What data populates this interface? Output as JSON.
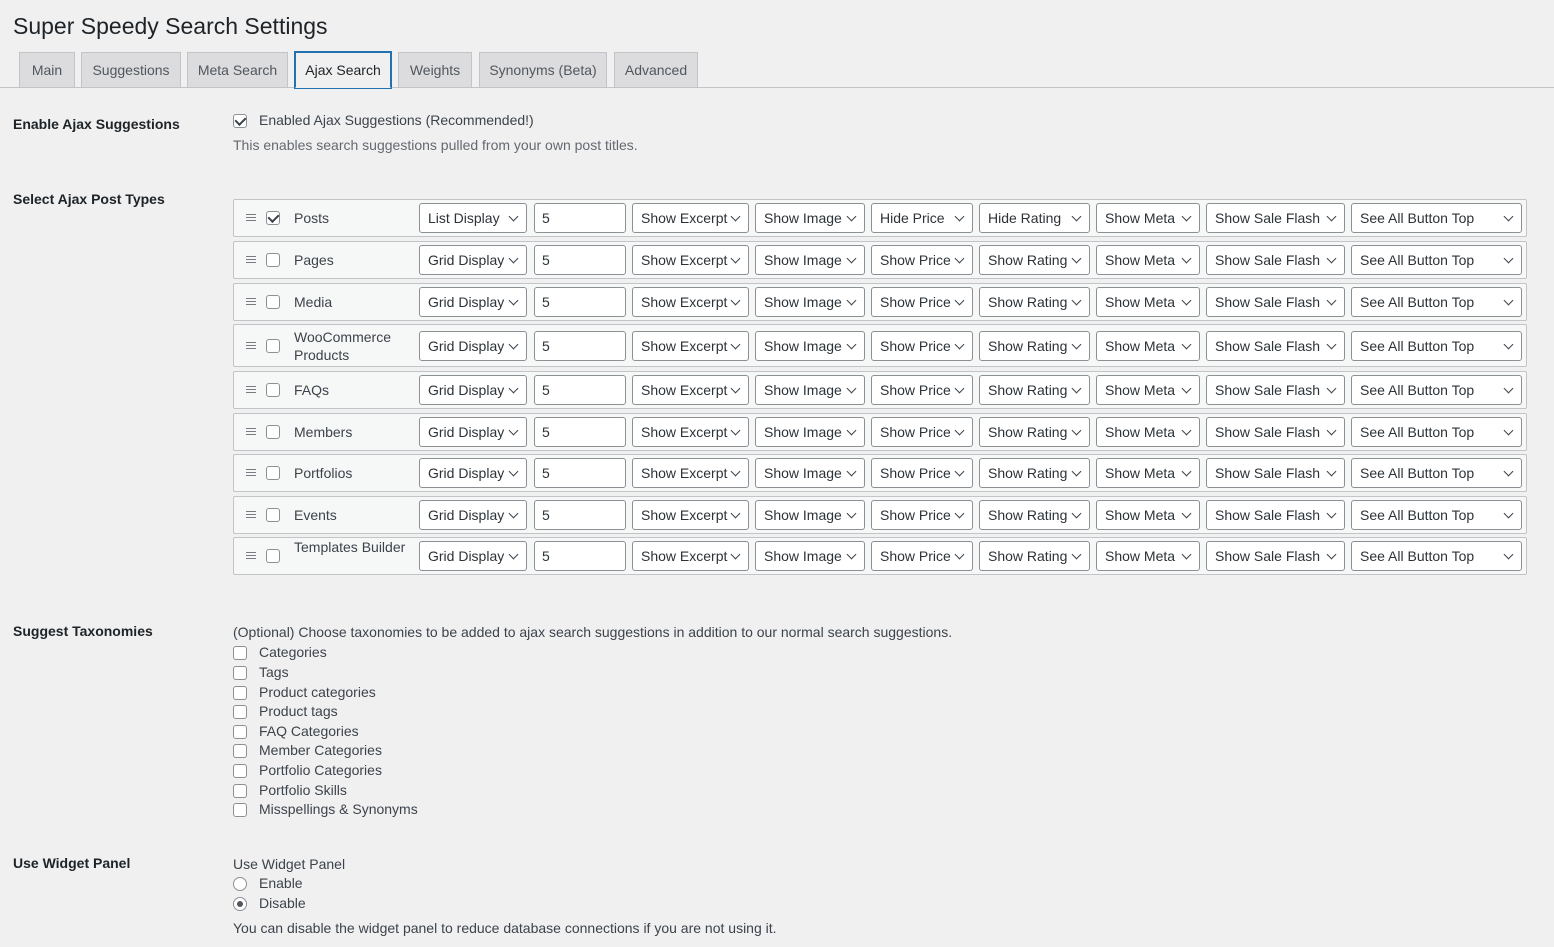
{
  "page_title": "Super Speedy Search Settings",
  "tabs": [
    {
      "label": "Main"
    },
    {
      "label": "Suggestions"
    },
    {
      "label": "Meta Search"
    },
    {
      "label": "Ajax Search",
      "active": true
    },
    {
      "label": "Weights"
    },
    {
      "label": "Synonyms (Beta)"
    },
    {
      "label": "Advanced"
    }
  ],
  "enable_ajax": {
    "label": "Enable Ajax Suggestions",
    "checkbox_label": "Enabled Ajax Suggestions (Recommended!)",
    "checked": true,
    "description": "This enables search suggestions pulled from your own post titles."
  },
  "post_types": {
    "label": "Select Ajax Post Types",
    "rows": [
      {
        "name": "Posts",
        "checked": true,
        "display": "List Display",
        "count": "5",
        "excerpt": "Show Excerpt",
        "image": "Show Image",
        "price": "Hide Price",
        "rating": "Hide Rating",
        "meta": "Show Meta",
        "sale": "Show Sale Flash",
        "see_all": "See All Button Top"
      },
      {
        "name": "Pages",
        "checked": false,
        "display": "Grid Display",
        "count": "5",
        "excerpt": "Show Excerpt",
        "image": "Show Image",
        "price": "Show Price",
        "rating": "Show Rating",
        "meta": "Show Meta",
        "sale": "Show Sale Flash",
        "see_all": "See All Button Top"
      },
      {
        "name": "Media",
        "checked": false,
        "display": "Grid Display",
        "count": "5",
        "excerpt": "Show Excerpt",
        "image": "Show Image",
        "price": "Show Price",
        "rating": "Show Rating",
        "meta": "Show Meta",
        "sale": "Show Sale Flash",
        "see_all": "See All Button Top"
      },
      {
        "name": "WooCommerce Products",
        "checked": false,
        "display": "Grid Display",
        "count": "5",
        "excerpt": "Show Excerpt",
        "image": "Show Image",
        "price": "Show Price",
        "rating": "Show Rating",
        "meta": "Show Meta",
        "sale": "Show Sale Flash",
        "see_all": "See All Button Top"
      },
      {
        "name": "FAQs",
        "checked": false,
        "display": "Grid Display",
        "count": "5",
        "excerpt": "Show Excerpt",
        "image": "Show Image",
        "price": "Show Price",
        "rating": "Show Rating",
        "meta": "Show Meta",
        "sale": "Show Sale Flash",
        "see_all": "See All Button Top"
      },
      {
        "name": "Members",
        "checked": false,
        "display": "Grid Display",
        "count": "5",
        "excerpt": "Show Excerpt",
        "image": "Show Image",
        "price": "Show Price",
        "rating": "Show Rating",
        "meta": "Show Meta",
        "sale": "Show Sale Flash",
        "see_all": "See All Button Top"
      },
      {
        "name": "Portfolios",
        "checked": false,
        "display": "Grid Display",
        "count": "5",
        "excerpt": "Show Excerpt",
        "image": "Show Image",
        "price": "Show Price",
        "rating": "Show Rating",
        "meta": "Show Meta",
        "sale": "Show Sale Flash",
        "see_all": "See All Button Top"
      },
      {
        "name": "Events",
        "checked": false,
        "display": "Grid Display",
        "count": "5",
        "excerpt": "Show Excerpt",
        "image": "Show Image",
        "price": "Show Price",
        "rating": "Show Rating",
        "meta": "Show Meta",
        "sale": "Show Sale Flash",
        "see_all": "See All Button Top"
      },
      {
        "name": "Templates Builder",
        "checked": false,
        "display": "Grid Display",
        "count": "5",
        "excerpt": "Show Excerpt",
        "image": "Show Image",
        "price": "Show Price",
        "rating": "Show Rating",
        "meta": "Show Meta",
        "sale": "Show Sale Flash",
        "see_all": "See All Button Top"
      }
    ]
  },
  "taxonomies": {
    "label": "Suggest Taxonomies",
    "intro": "(Optional) Choose taxonomies to be added to ajax search suggestions in addition to our normal search suggestions.",
    "items": [
      {
        "label": "Categories",
        "checked": false
      },
      {
        "label": "Tags",
        "checked": false
      },
      {
        "label": "Product categories",
        "checked": false
      },
      {
        "label": "Product tags",
        "checked": false
      },
      {
        "label": "FAQ Categories",
        "checked": false
      },
      {
        "label": "Member Categories",
        "checked": false
      },
      {
        "label": "Portfolio Categories",
        "checked": false
      },
      {
        "label": "Portfolio Skills",
        "checked": false
      },
      {
        "label": "Misspellings & Synonyms",
        "checked": false
      }
    ]
  },
  "widget_panel": {
    "label": "Use Widget Panel",
    "heading": "Use Widget Panel",
    "options": [
      {
        "label": "Enable",
        "checked": false
      },
      {
        "label": "Disable",
        "checked": true
      }
    ],
    "description": "You can disable the widget panel to reduce database connections if you are not using it."
  }
}
